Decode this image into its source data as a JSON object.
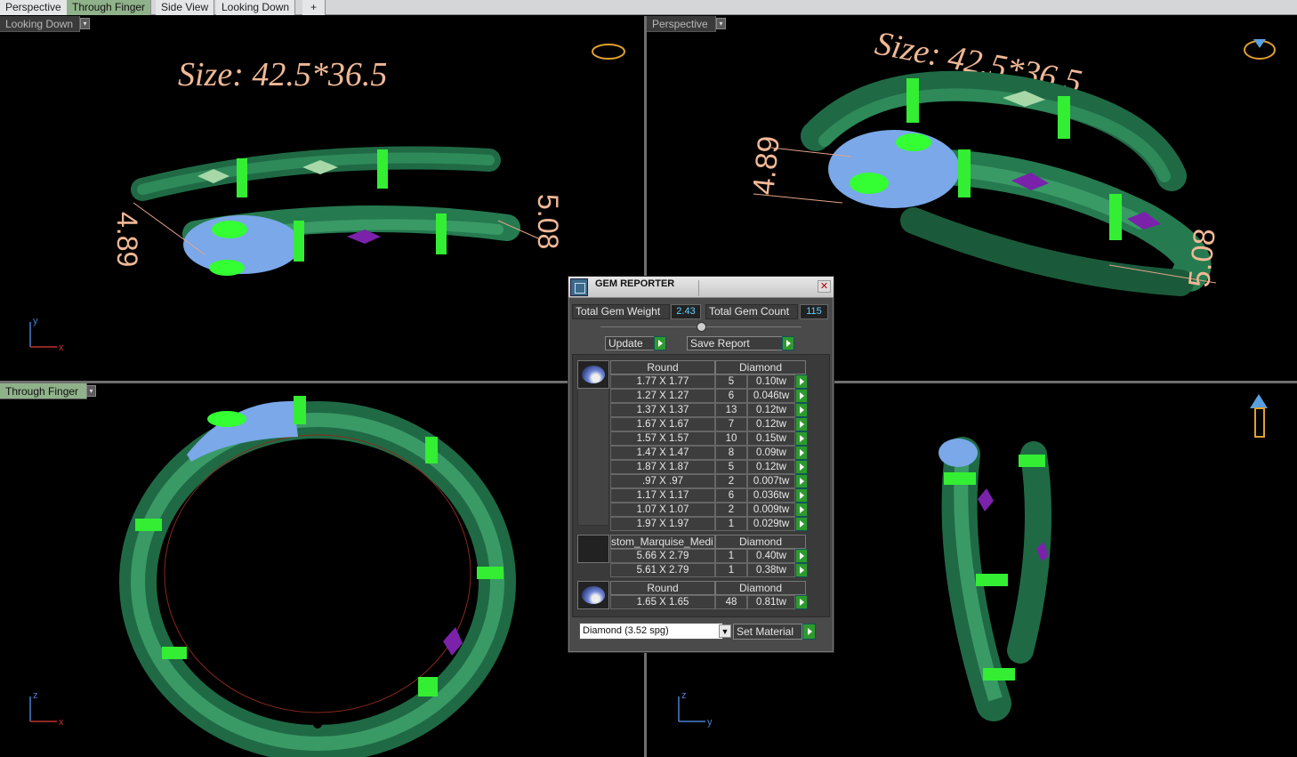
{
  "tabs": [
    "Perspective",
    "Through Finger",
    "Side View",
    "Looking Down"
  ],
  "add_tab_glyph": "+",
  "viewports": {
    "top_left": {
      "label": "Looking Down",
      "size_text": "Size: 42.5*36.5",
      "dim_left": "4.89",
      "dim_right": "5.08",
      "axes": {
        "v": "y",
        "h": "x"
      }
    },
    "top_right": {
      "label": "Perspective",
      "size_text": "Size: 42.5*36.5",
      "dim_left": "4.89",
      "dim_right": "5.08"
    },
    "bottom_left": {
      "label": "Through Finger",
      "axes": {
        "v": "z",
        "h": "x"
      }
    },
    "bottom_right": {
      "axes": {
        "v": "z",
        "h": "y"
      }
    }
  },
  "dialog": {
    "title": "GEM REPORTER",
    "total_weight_label": "Total Gem Weight",
    "total_weight": "2.43",
    "total_count_label": "Total Gem Count",
    "total_count": "115",
    "update_label": "Update",
    "save_label": "Save Report",
    "groups": [
      {
        "shape": "Round",
        "material": "Diamond",
        "rows": [
          {
            "size": "1.77 X 1.77",
            "count": "5",
            "weight": "0.10tw"
          },
          {
            "size": "1.27 X 1.27",
            "count": "6",
            "weight": "0.046tw"
          },
          {
            "size": "1.37 X 1.37",
            "count": "13",
            "weight": "0.12tw"
          },
          {
            "size": "1.67 X 1.67",
            "count": "7",
            "weight": "0.12tw"
          },
          {
            "size": "1.57 X 1.57",
            "count": "10",
            "weight": "0.15tw"
          },
          {
            "size": "1.47 X 1.47",
            "count": "8",
            "weight": "0.09tw"
          },
          {
            "size": "1.87 X 1.87",
            "count": "5",
            "weight": "0.12tw"
          },
          {
            "size": ".97 X .97",
            "count": "2",
            "weight": "0.007tw"
          },
          {
            "size": "1.17 X 1.17",
            "count": "6",
            "weight": "0.036tw"
          },
          {
            "size": "1.07 X 1.07",
            "count": "2",
            "weight": "0.009tw"
          },
          {
            "size": "1.97 X 1.97",
            "count": "1",
            "weight": "0.029tw"
          }
        ]
      },
      {
        "shape": "stom_Marquise_Medi",
        "material": "Diamond",
        "rows": [
          {
            "size": "5.66 X 2.79",
            "count": "1",
            "weight": "0.40tw"
          },
          {
            "size": "5.61 X 2.79",
            "count": "1",
            "weight": "0.38tw"
          }
        ]
      },
      {
        "shape": "Round",
        "material": "Diamond",
        "rows": [
          {
            "size": "1.65 X 1.65",
            "count": "48",
            "weight": "0.81tw"
          }
        ]
      }
    ],
    "material_select": "Diamond    (3.52 spg)",
    "set_material_label": "Set Material"
  }
}
